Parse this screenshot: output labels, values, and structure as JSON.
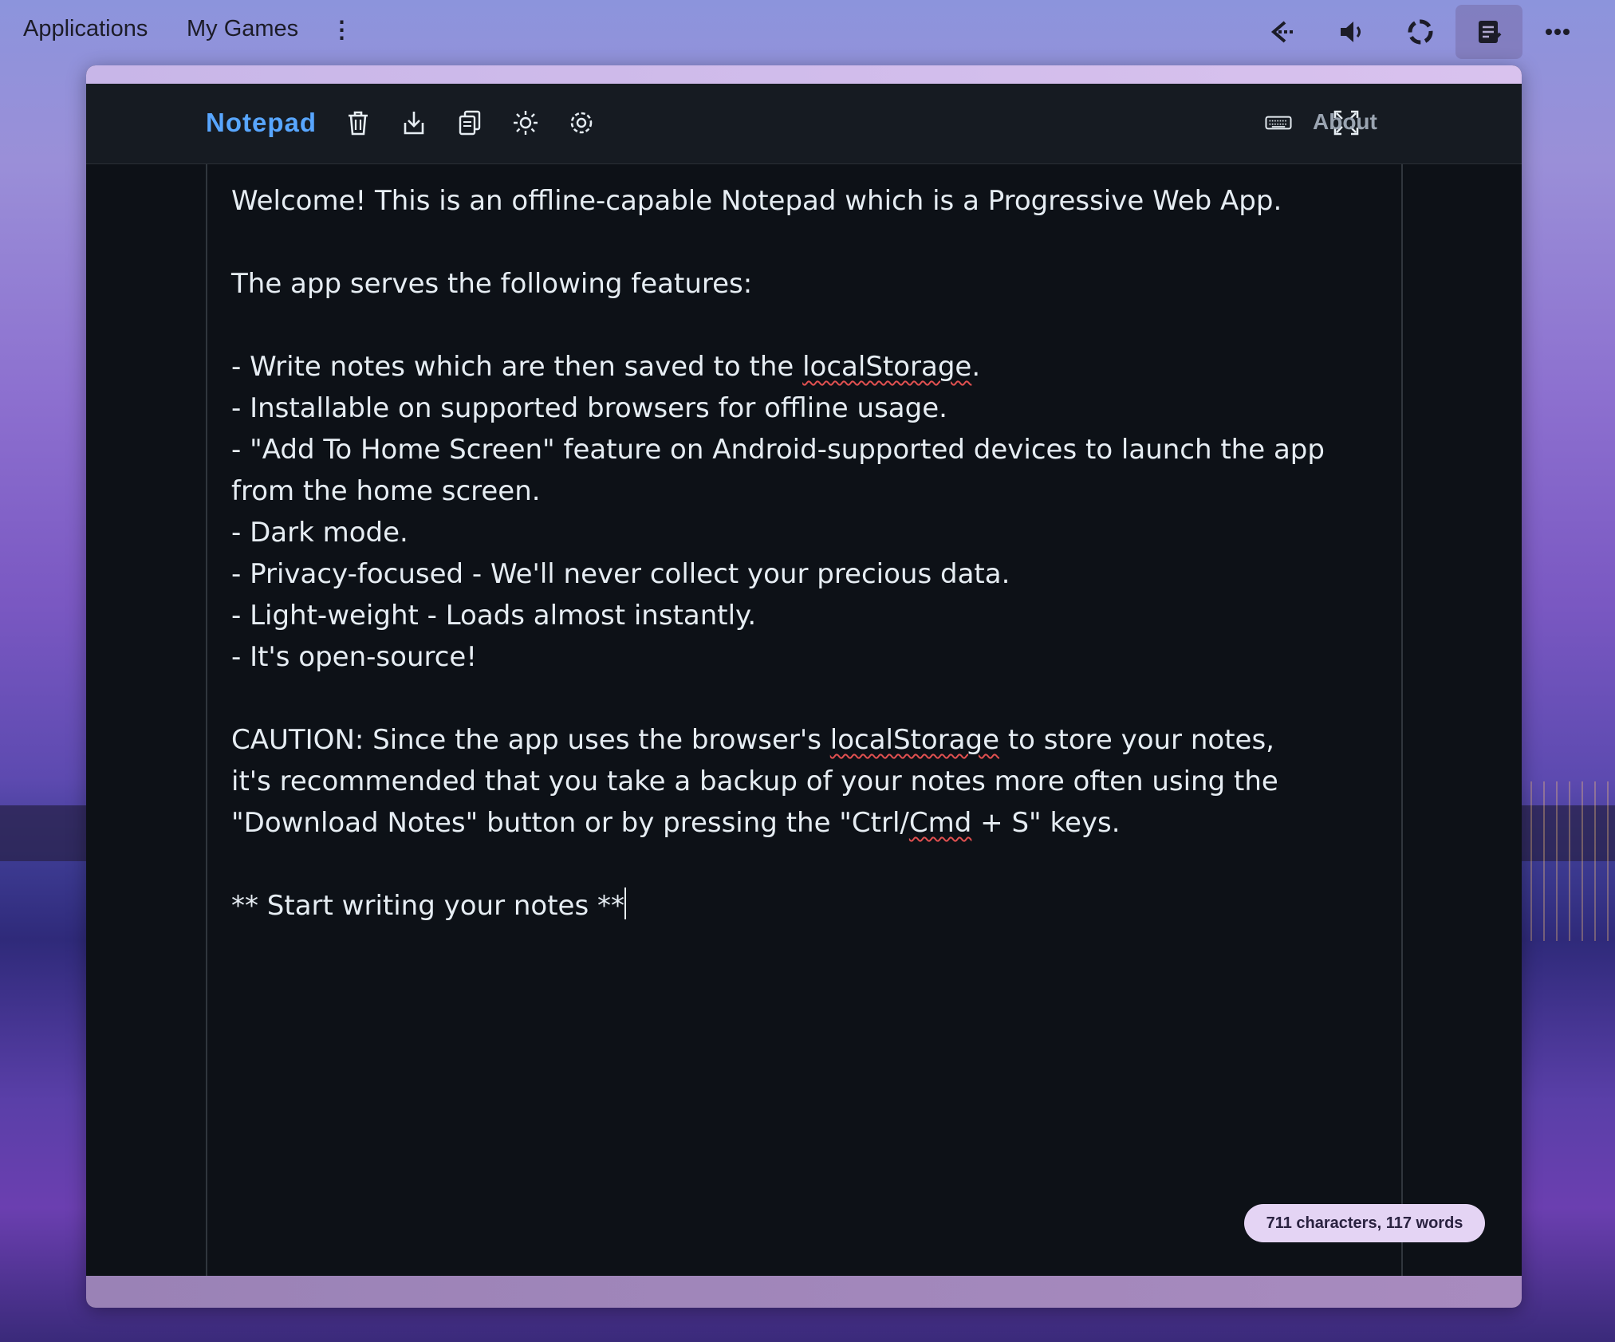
{
  "desktop": {
    "menu": [
      {
        "label": "Applications"
      },
      {
        "label": "My Games"
      },
      {
        "label": "⋮"
      }
    ],
    "tray_icons": [
      "back-arrow-icon",
      "volume-icon",
      "refresh-icon",
      "notepad-icon",
      "more-icon"
    ],
    "active_tray": "notepad-icon"
  },
  "app": {
    "brand": "Notepad",
    "toolbar_icons": [
      "trash-icon",
      "download-icon",
      "copy-icon",
      "sun-icon",
      "gear-icon"
    ],
    "right_icons": [
      "keyboard-icon",
      "fullscreen-icon"
    ],
    "about_label": "About",
    "colors": {
      "brand": "#58a6ff",
      "editor_bg": "#0d1117",
      "appbar_bg": "#161b22",
      "counter_bg": "#e4d4f4"
    }
  },
  "editor": {
    "lines": [
      "Welcome! This is an offline-capable Notepad which is a Progressive Web App.",
      "",
      "The app serves the following features:",
      "",
      "- Write notes which are then saved to the localStorage.",
      "- Installable on supported browsers for offline usage.",
      "- \"Add To Home Screen\" feature on Android-supported devices to launch the app from the home screen.",
      "- Dark mode.",
      "- Privacy-focused - We'll never collect your precious data.",
      "- Light-weight - Loads almost instantly.",
      "- It's open-source!",
      "",
      "CAUTION: Since the app uses the browser's localStorage to store your notes,",
      "it's recommended that you take a backup of your notes more often using the",
      "\"Download Notes\" button or by pressing the \"Ctrl/Cmd + S\" keys.",
      "",
      "** Start writing your notes **"
    ],
    "misspelled_words": [
      "localStorage",
      "Cmd"
    ]
  },
  "status": {
    "counter": "711 characters, 117 words"
  }
}
